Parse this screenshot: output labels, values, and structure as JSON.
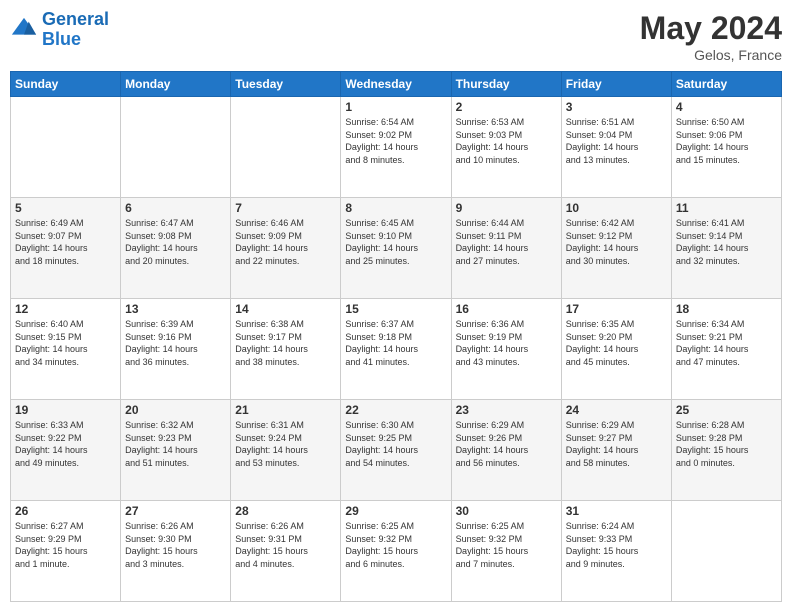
{
  "header": {
    "logo_line1": "General",
    "logo_line2": "Blue",
    "month_year": "May 2024",
    "location": "Gelos, France"
  },
  "days_of_week": [
    "Sunday",
    "Monday",
    "Tuesday",
    "Wednesday",
    "Thursday",
    "Friday",
    "Saturday"
  ],
  "weeks": [
    [
      {
        "day": "",
        "info": ""
      },
      {
        "day": "",
        "info": ""
      },
      {
        "day": "",
        "info": ""
      },
      {
        "day": "1",
        "info": "Sunrise: 6:54 AM\nSunset: 9:02 PM\nDaylight: 14 hours\nand 8 minutes."
      },
      {
        "day": "2",
        "info": "Sunrise: 6:53 AM\nSunset: 9:03 PM\nDaylight: 14 hours\nand 10 minutes."
      },
      {
        "day": "3",
        "info": "Sunrise: 6:51 AM\nSunset: 9:04 PM\nDaylight: 14 hours\nand 13 minutes."
      },
      {
        "day": "4",
        "info": "Sunrise: 6:50 AM\nSunset: 9:06 PM\nDaylight: 14 hours\nand 15 minutes."
      }
    ],
    [
      {
        "day": "5",
        "info": "Sunrise: 6:49 AM\nSunset: 9:07 PM\nDaylight: 14 hours\nand 18 minutes."
      },
      {
        "day": "6",
        "info": "Sunrise: 6:47 AM\nSunset: 9:08 PM\nDaylight: 14 hours\nand 20 minutes."
      },
      {
        "day": "7",
        "info": "Sunrise: 6:46 AM\nSunset: 9:09 PM\nDaylight: 14 hours\nand 22 minutes."
      },
      {
        "day": "8",
        "info": "Sunrise: 6:45 AM\nSunset: 9:10 PM\nDaylight: 14 hours\nand 25 minutes."
      },
      {
        "day": "9",
        "info": "Sunrise: 6:44 AM\nSunset: 9:11 PM\nDaylight: 14 hours\nand 27 minutes."
      },
      {
        "day": "10",
        "info": "Sunrise: 6:42 AM\nSunset: 9:12 PM\nDaylight: 14 hours\nand 30 minutes."
      },
      {
        "day": "11",
        "info": "Sunrise: 6:41 AM\nSunset: 9:14 PM\nDaylight: 14 hours\nand 32 minutes."
      }
    ],
    [
      {
        "day": "12",
        "info": "Sunrise: 6:40 AM\nSunset: 9:15 PM\nDaylight: 14 hours\nand 34 minutes."
      },
      {
        "day": "13",
        "info": "Sunrise: 6:39 AM\nSunset: 9:16 PM\nDaylight: 14 hours\nand 36 minutes."
      },
      {
        "day": "14",
        "info": "Sunrise: 6:38 AM\nSunset: 9:17 PM\nDaylight: 14 hours\nand 38 minutes."
      },
      {
        "day": "15",
        "info": "Sunrise: 6:37 AM\nSunset: 9:18 PM\nDaylight: 14 hours\nand 41 minutes."
      },
      {
        "day": "16",
        "info": "Sunrise: 6:36 AM\nSunset: 9:19 PM\nDaylight: 14 hours\nand 43 minutes."
      },
      {
        "day": "17",
        "info": "Sunrise: 6:35 AM\nSunset: 9:20 PM\nDaylight: 14 hours\nand 45 minutes."
      },
      {
        "day": "18",
        "info": "Sunrise: 6:34 AM\nSunset: 9:21 PM\nDaylight: 14 hours\nand 47 minutes."
      }
    ],
    [
      {
        "day": "19",
        "info": "Sunrise: 6:33 AM\nSunset: 9:22 PM\nDaylight: 14 hours\nand 49 minutes."
      },
      {
        "day": "20",
        "info": "Sunrise: 6:32 AM\nSunset: 9:23 PM\nDaylight: 14 hours\nand 51 minutes."
      },
      {
        "day": "21",
        "info": "Sunrise: 6:31 AM\nSunset: 9:24 PM\nDaylight: 14 hours\nand 53 minutes."
      },
      {
        "day": "22",
        "info": "Sunrise: 6:30 AM\nSunset: 9:25 PM\nDaylight: 14 hours\nand 54 minutes."
      },
      {
        "day": "23",
        "info": "Sunrise: 6:29 AM\nSunset: 9:26 PM\nDaylight: 14 hours\nand 56 minutes."
      },
      {
        "day": "24",
        "info": "Sunrise: 6:29 AM\nSunset: 9:27 PM\nDaylight: 14 hours\nand 58 minutes."
      },
      {
        "day": "25",
        "info": "Sunrise: 6:28 AM\nSunset: 9:28 PM\nDaylight: 15 hours\nand 0 minutes."
      }
    ],
    [
      {
        "day": "26",
        "info": "Sunrise: 6:27 AM\nSunset: 9:29 PM\nDaylight: 15 hours\nand 1 minute."
      },
      {
        "day": "27",
        "info": "Sunrise: 6:26 AM\nSunset: 9:30 PM\nDaylight: 15 hours\nand 3 minutes."
      },
      {
        "day": "28",
        "info": "Sunrise: 6:26 AM\nSunset: 9:31 PM\nDaylight: 15 hours\nand 4 minutes."
      },
      {
        "day": "29",
        "info": "Sunrise: 6:25 AM\nSunset: 9:32 PM\nDaylight: 15 hours\nand 6 minutes."
      },
      {
        "day": "30",
        "info": "Sunrise: 6:25 AM\nSunset: 9:32 PM\nDaylight: 15 hours\nand 7 minutes."
      },
      {
        "day": "31",
        "info": "Sunrise: 6:24 AM\nSunset: 9:33 PM\nDaylight: 15 hours\nand 9 minutes."
      },
      {
        "day": "",
        "info": ""
      }
    ]
  ]
}
